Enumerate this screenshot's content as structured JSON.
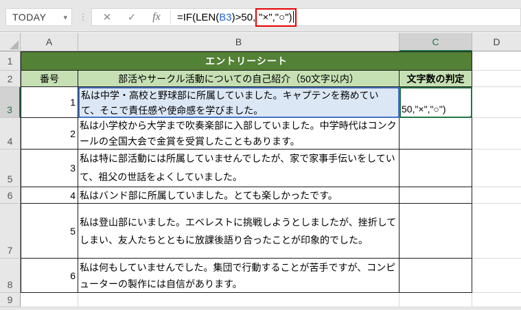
{
  "app": {
    "name_box_value": "TODAY"
  },
  "formula_bar": {
    "formula_part1": "=IF(LEN(",
    "formula_ref": "B3",
    "formula_part2": ")>50,",
    "formula_boxed": "\"×\",\"○\")",
    "cancel_icon": "✕",
    "enter_icon": "✓",
    "fx_icon": "fx",
    "name_dropdown_icon": "▾",
    "resize_dots_icon": "⋮"
  },
  "sheet": {
    "columns": [
      "A",
      "B",
      "C",
      "D"
    ],
    "active_column": "C",
    "row_headers": [
      "1",
      "2",
      "3",
      "4",
      "5",
      "6",
      "7",
      "8",
      "9"
    ],
    "active_row": "3",
    "title_banner": "エントリーシート",
    "table_headers": {
      "number": "番号",
      "intro": "部活やサークル活動についての自己紹介（50文字以内）",
      "judgment": "文字数の判定"
    },
    "entries": [
      {
        "number": "1",
        "text": "私は中学・高校と野球部に所属していました。キャプテンを務めていて、そこで責任感や使命感を学びました。"
      },
      {
        "number": "2",
        "text": "私は小学校から大学まで吹奏楽部に入部していました。中学時代はコンクールの全国大会で金賞を受賞したこともあります。"
      },
      {
        "number": "3",
        "text": "私は特に部活動には所属していませんでしたが、家で家事手伝いをしていて、祖父の世話をよくしていました。"
      },
      {
        "number": "4",
        "text": "私はバンド部に所属していました。とても楽しかったです。"
      },
      {
        "number": "5",
        "text": "私は登山部にいました。エベレストに挑戦しようとしましたが、挫折してしまい、友人たちとともに放課後語り合ったことが印象的でした。"
      },
      {
        "number": "6",
        "text": "私は何もしていませんでした。集団で行動することが苦手ですが、コンピューターの製作には自信があります。"
      }
    ],
    "edit_overflow_text": "50,\"×\",\"○\")"
  },
  "colors": {
    "banner_green": "#538135",
    "header_light_green": "#c6e0b4",
    "selection_blue": "#4472c4",
    "reference_fill_blue": "#dce7f5",
    "edit_border_green": "#217346",
    "annotation_red": "#e60000",
    "formula_ref_blue": "#2565d0"
  }
}
